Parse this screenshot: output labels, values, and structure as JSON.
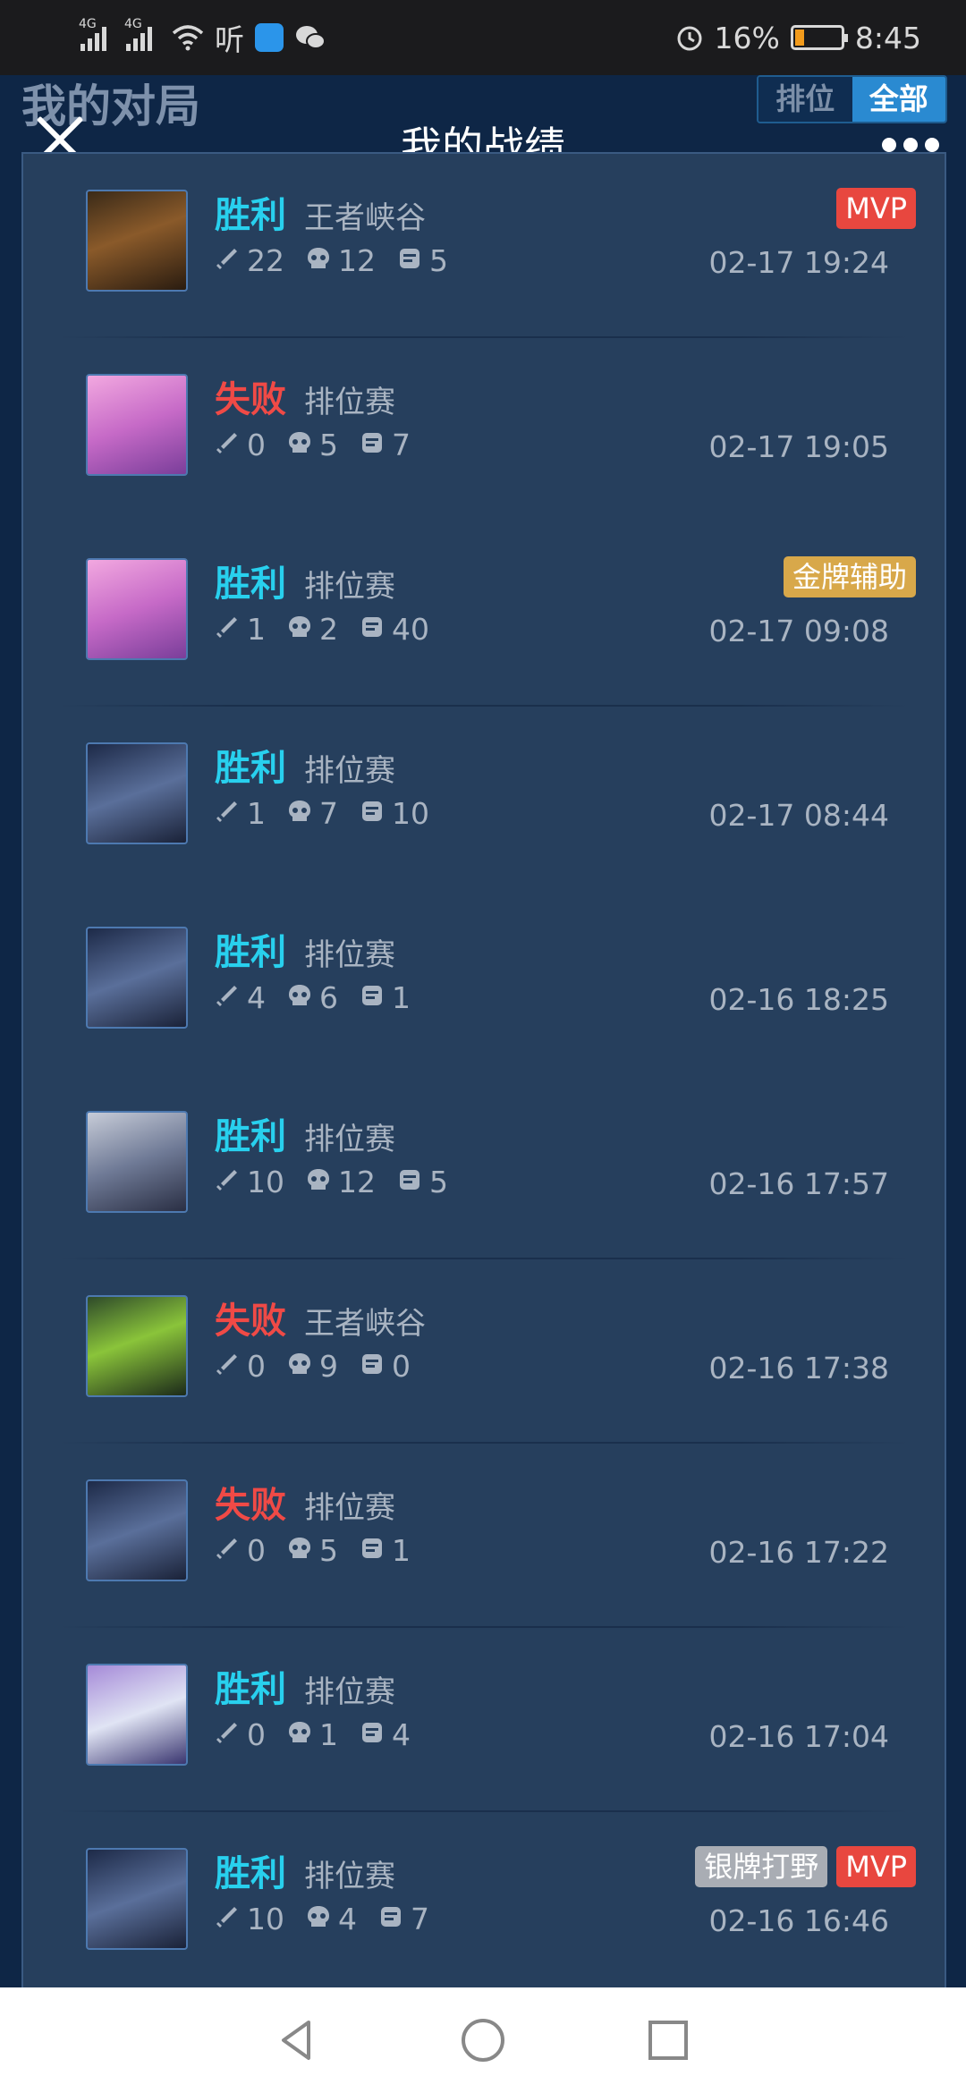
{
  "status_bar": {
    "net1": "4G",
    "net2": "4G",
    "listen_char": "听",
    "battery_pct": "16%",
    "time": "8:45",
    "icons": [
      "signal-icon",
      "signal-icon",
      "wifi-icon",
      "app-icon",
      "wechat-icon",
      "alarm-icon",
      "battery-icon"
    ]
  },
  "header": {
    "background_title": "我的对局",
    "tab_rank": "排位",
    "tab_all": "全部",
    "title": "我的战绩"
  },
  "colors": {
    "win": "#28d0ee",
    "lose": "#f04a46",
    "mvp": "#e8473f",
    "gold": "#d8a84a",
    "silver": "#a9adb4",
    "panel": "#263f5d"
  },
  "matches": [
    {
      "result": "胜利",
      "win": true,
      "mode": "王者峡谷",
      "kills": "22",
      "deaths": "12",
      "assists": "5",
      "time": "02-17 19:24",
      "badges": [
        {
          "label": "MVP",
          "type": "mvp"
        }
      ]
    },
    {
      "result": "失败",
      "win": false,
      "mode": "排位赛",
      "kills": "0",
      "deaths": "5",
      "assists": "7",
      "time": "02-17 19:05",
      "badges": []
    },
    {
      "result": "胜利",
      "win": true,
      "mode": "排位赛",
      "kills": "1",
      "deaths": "2",
      "assists": "40",
      "time": "02-17 09:08",
      "badges": [
        {
          "label": "金牌辅助",
          "type": "gold"
        }
      ]
    },
    {
      "result": "胜利",
      "win": true,
      "mode": "排位赛",
      "kills": "1",
      "deaths": "7",
      "assists": "10",
      "time": "02-17 08:44",
      "badges": []
    },
    {
      "result": "胜利",
      "win": true,
      "mode": "排位赛",
      "kills": "4",
      "deaths": "6",
      "assists": "1",
      "time": "02-16 18:25",
      "badges": []
    },
    {
      "result": "胜利",
      "win": true,
      "mode": "排位赛",
      "kills": "10",
      "deaths": "12",
      "assists": "5",
      "time": "02-16 17:57",
      "badges": []
    },
    {
      "result": "失败",
      "win": false,
      "mode": "王者峡谷",
      "kills": "0",
      "deaths": "9",
      "assists": "0",
      "time": "02-16 17:38",
      "badges": []
    },
    {
      "result": "失败",
      "win": false,
      "mode": "排位赛",
      "kills": "0",
      "deaths": "5",
      "assists": "1",
      "time": "02-16 17:22",
      "badges": []
    },
    {
      "result": "胜利",
      "win": true,
      "mode": "排位赛",
      "kills": "0",
      "deaths": "1",
      "assists": "4",
      "time": "02-16 17:04",
      "badges": []
    },
    {
      "result": "胜利",
      "win": true,
      "mode": "排位赛",
      "kills": "10",
      "deaths": "4",
      "assists": "7",
      "time": "02-16 16:46",
      "badges": [
        {
          "label": "银牌打野",
          "type": "silver"
        },
        {
          "label": "MVP",
          "type": "mvp"
        }
      ]
    }
  ],
  "nav": {
    "icons": [
      "back-triangle-icon",
      "home-circle-icon",
      "recent-square-icon"
    ]
  }
}
